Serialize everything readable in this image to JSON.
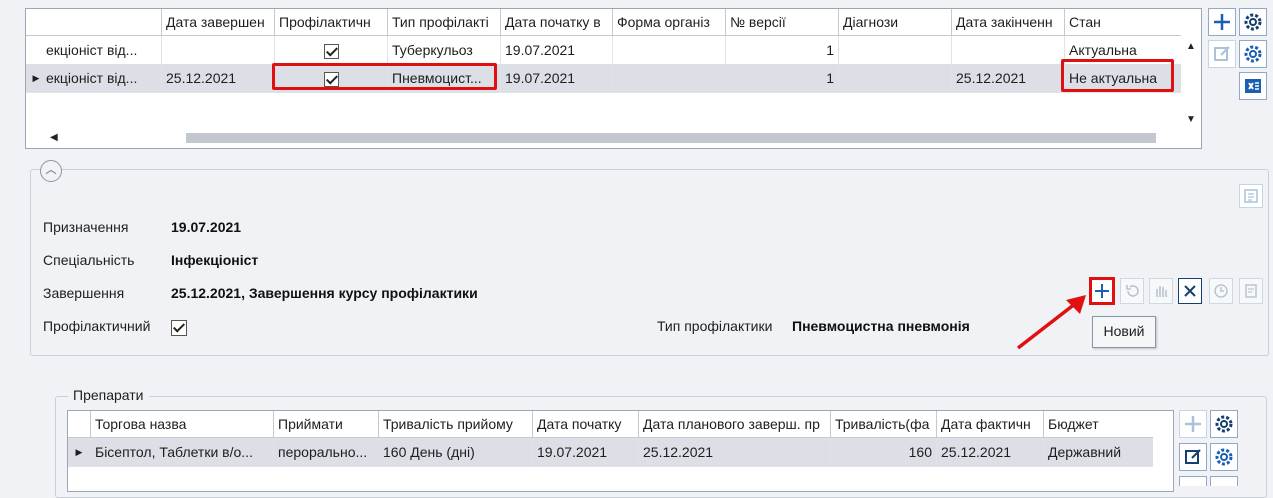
{
  "top_table": {
    "columns": [
      "",
      "Дата завершен",
      "Профілактичн",
      "Тип профілакті",
      "Дата початку в",
      "Форма організ",
      "№ версії",
      "Діагнози",
      "Дата закінченн",
      "Стан"
    ],
    "rows": [
      {
        "col0": "екціоніст від...",
        "end_date": "",
        "preventive": true,
        "type": "Туберкульоз",
        "start": "19.07.2021",
        "form": "",
        "version": "1",
        "diagnoses": "",
        "finish": "",
        "state": "Актуальна"
      },
      {
        "col0": "екціоніст від...",
        "end_date": "25.12.2021",
        "preventive": true,
        "type": "Пневмоцист...",
        "start": "19.07.2021",
        "form": "",
        "version": "1",
        "diagnoses": "",
        "finish": "25.12.2021",
        "state": "Не актуальна"
      }
    ],
    "row_indicator": "▶",
    "scroll_left": "◀",
    "scroll_up": "▲",
    "scroll_down": "▼"
  },
  "details": {
    "collapse_icon": "︿",
    "assignment_label": "Призначення",
    "assignment_value": "19.07.2021",
    "specialty_label": "Спеціальність",
    "specialty_value": "Інфекціоніст",
    "completion_label": "Завершення",
    "completion_value": "25.12.2021, Завершення курсу профілактики",
    "preventive_label": "Профілактичний",
    "preventive_checked": true,
    "type_label": "Тип профілактики",
    "type_value": "Пневмоцистна пневмонія",
    "tooltip": "Новий"
  },
  "preparations": {
    "legend": "Препарати",
    "columns": [
      "",
      "Торгова назва",
      "Приймати",
      "Тривалість прийому",
      "Дата початку",
      "Дата планового заверш. пр",
      "Тривалість(фа",
      "Дата фактичн",
      "Бюджет"
    ],
    "rows": [
      {
        "name": "Бісептол, Таблетки в/о...",
        "route": "перорально...",
        "duration": "160 День (дні)",
        "start": "19.07.2021",
        "planned_end": "25.12.2021",
        "actual_duration": "160",
        "actual_date": "25.12.2021",
        "budget": "Державний"
      }
    ]
  },
  "colors": {
    "accent": "#1a5fb4",
    "highlight": "#e01010",
    "selected_row": "#dcdfe6"
  }
}
